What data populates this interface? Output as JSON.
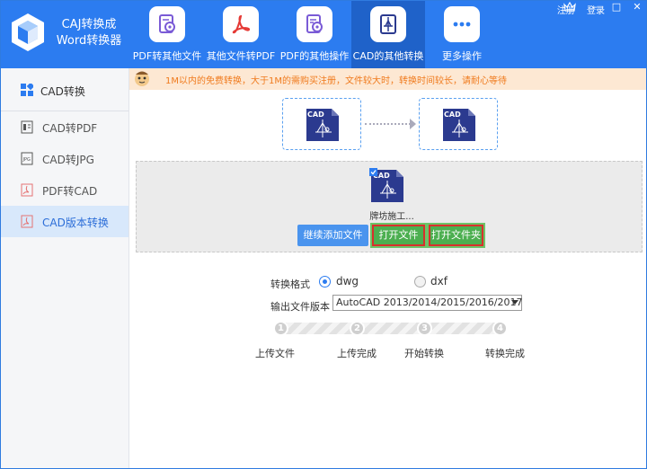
{
  "app": {
    "title_line1": "CAJ转换成",
    "title_line2": "Word转换器"
  },
  "tabs": [
    {
      "label": "PDF转其他文件",
      "icon": "pdf-gear-icon",
      "active": false
    },
    {
      "label": "其他文件转PDF",
      "icon": "acrobat-icon",
      "active": false
    },
    {
      "label": "PDF的其他操作",
      "icon": "doc-gear-icon",
      "active": false
    },
    {
      "label": "CAD的其他转换",
      "icon": "cad-icon",
      "active": true
    },
    {
      "label": "更多操作",
      "icon": "more-icon",
      "active": false
    }
  ],
  "top_links": {
    "register": "注册",
    "login": "登录"
  },
  "notice": "1M以内的免费转换，大于1M的需购买注册，文件较大时，转换时间较长，请耐心等待",
  "sidebar": {
    "header": "CAD转换",
    "items": [
      {
        "label": "CAD转PDF",
        "icon": "pdf-file-icon",
        "active": false
      },
      {
        "label": "CAD转JPG",
        "icon": "jpg-file-icon",
        "active": false
      },
      {
        "label": "PDF转CAD",
        "icon": "pdf-to-cad-icon",
        "active": false
      },
      {
        "label": "CAD版本转换",
        "icon": "cad-version-icon",
        "active": true
      }
    ]
  },
  "conversion": {
    "source_badge": "CAD",
    "target_badge": "CAD"
  },
  "uploaded_file": {
    "name": "牌坊施工...",
    "badge": "CAD"
  },
  "buttons": {
    "add_files": "继续添加文件",
    "open_file": "打开文件",
    "open_folder": "打开文件夹"
  },
  "settings": {
    "format_label": "转换格式",
    "format_options": [
      {
        "label": "dwg",
        "selected": true
      },
      {
        "label": "dxf",
        "selected": false
      }
    ],
    "version_label": "输出文件版本",
    "version_value": "AutoCAD 2013/2014/2015/2016/2017"
  },
  "steps": [
    {
      "num": "1",
      "label": "上传文件"
    },
    {
      "num": "2",
      "label": "上传完成"
    },
    {
      "num": "3",
      "label": "开始转换"
    },
    {
      "num": "4",
      "label": "转换完成"
    }
  ],
  "colors": {
    "primary": "#2c7cf0",
    "active_tab": "#1f62c9",
    "notice_bg": "#fde8d3",
    "notice_text": "#f07b1e",
    "cad_file": "#2b3a8f",
    "button_green": "#4caf50",
    "highlight_red": "#d9302c"
  }
}
